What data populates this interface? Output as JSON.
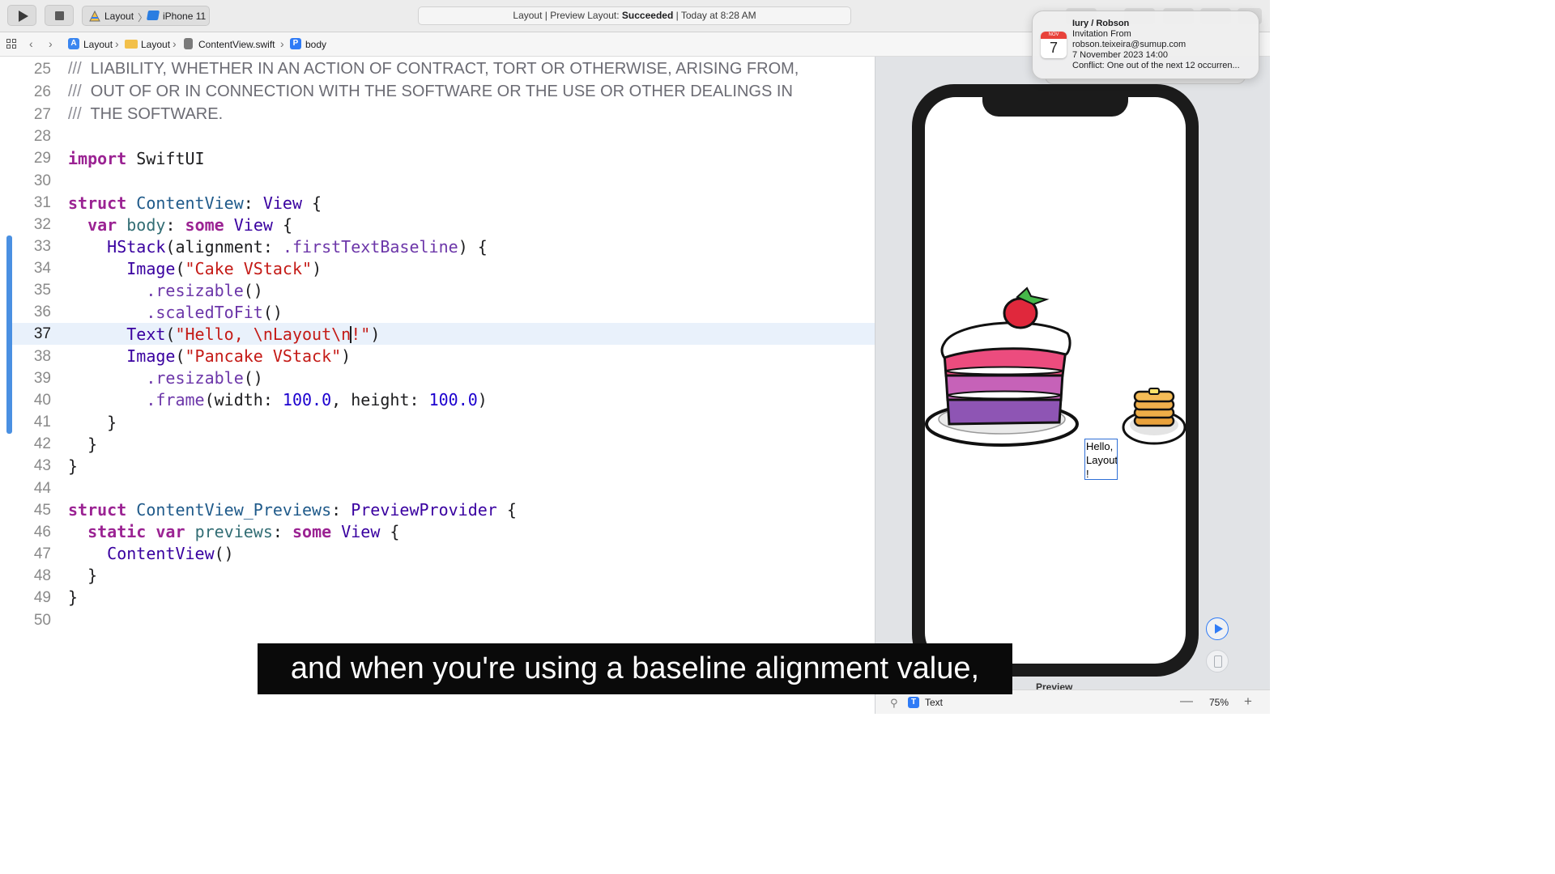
{
  "toolbar": {
    "scheme": {
      "project": "Layout",
      "device": "iPhone 11"
    },
    "status": {
      "prefix": "Layout | Preview Layout: ",
      "result": "Succeeded",
      "suffix": " | Today at 8:28 AM"
    }
  },
  "notification": {
    "calendar_month": "NOV",
    "calendar_day": "7",
    "title": "Iury / Robson",
    "line1": "Invitation From",
    "line2": "robson.teixeira@sumup.com",
    "line3": "7 November 2023 14:00",
    "line4": "Conflict: One out of the next 12 occurren..."
  },
  "jumpbar": {
    "crumbs": [
      "Layout",
      "Layout",
      "ContentView.swift",
      "body"
    ]
  },
  "editor": {
    "current_line": 37,
    "line_numbers": [
      "25",
      "26",
      "27",
      "28",
      "29",
      "30",
      "31",
      "32",
      "33",
      "34",
      "35",
      "36",
      "37",
      "38",
      "39",
      "40",
      "41",
      "42",
      "43",
      "44",
      "45",
      "46",
      "47",
      "48",
      "49",
      "50"
    ],
    "doc_comments": [
      "LIABILITY, WHETHER IN AN ACTION OF CONTRACT, TORT OR OTHERWISE, ARISING FROM,",
      "OUT OF OR IN CONNECTION WITH THE SOFTWARE OR THE USE OR OTHER DEALINGS IN",
      "THE SOFTWARE."
    ],
    "comment_prefix": "///",
    "tokens": {
      "import_kw": "import",
      "module": "SwiftUI",
      "struct_kw": "struct",
      "content_view": "ContentView",
      "view_type": "View",
      "var_kw": "var",
      "body": "body",
      "some_kw": "some",
      "hstack": "HStack",
      "alignment_label": "alignment:",
      "first_text_baseline": ".firstTextBaseline",
      "image_fn": "Image",
      "cake_str": "\"Cake VStack\"",
      "resizable": ".resizable",
      "scaled_to_fit": ".scaledToFit",
      "text_fn": "Text",
      "hello_str_a": "\"Hello, \\nLayout\\n",
      "hello_str_b": "!\"",
      "pancake_str": "\"Pancake VStack\"",
      "frame": ".frame",
      "width_label": "width:",
      "height_label": "height:",
      "width_val": "100.0",
      "height_val": "100.0",
      "previews_struct": "ContentView_Previews",
      "preview_provider": "PreviewProvider",
      "static_kw": "static",
      "previews": "previews",
      "content_view_call": "ContentView"
    }
  },
  "preview": {
    "hello_text": "Hello,\nLayout\n!",
    "label": "Preview",
    "selection_type": "Text",
    "zoom": "75%"
  },
  "caption": "and when you're using a baseline alignment value,",
  "colors": {
    "keyword": "#9b2393",
    "string": "#c41a16",
    "number": "#1c00cf",
    "method": "#6c36a9",
    "type": "#1f5a8a",
    "accent": "#2f7bf6",
    "selection_border": "#2f6fd6"
  },
  "icons": [
    "run-icon",
    "stop-icon",
    "xcode-app-icon",
    "device-icon",
    "calendar-icon",
    "grid-icon",
    "back-chevron-icon",
    "forward-chevron-icon",
    "project-icon",
    "folder-icon",
    "swift-file-icon",
    "property-icon",
    "live-preview-icon",
    "device-settings-icon",
    "pin-icon",
    "text-element-icon"
  ]
}
